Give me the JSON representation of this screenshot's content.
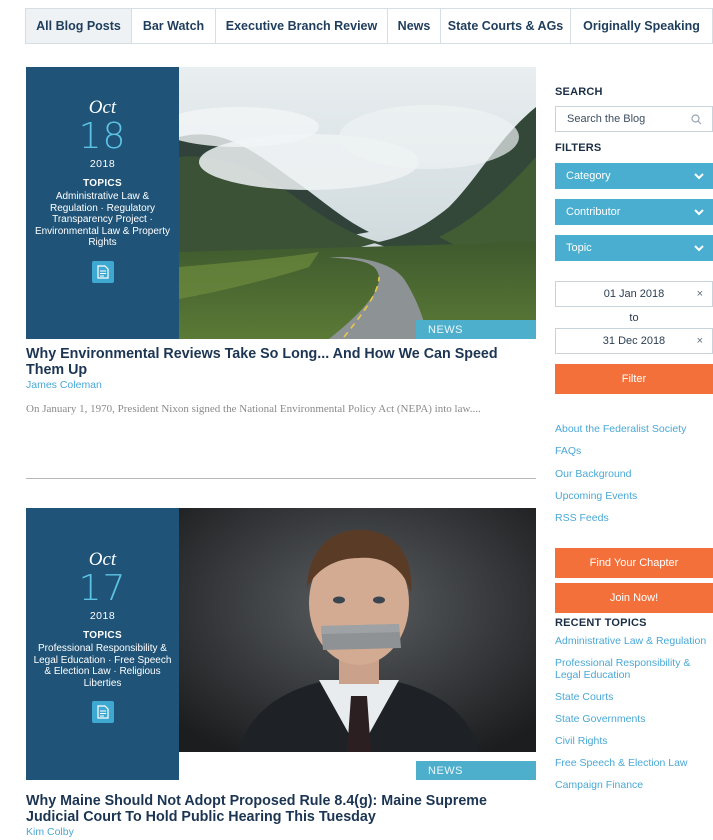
{
  "tabs": [
    {
      "label": "All Blog Posts"
    },
    {
      "label": "Bar Watch"
    },
    {
      "label": "Executive Branch Review"
    },
    {
      "label": "News"
    },
    {
      "label": "State Courts & AGs"
    },
    {
      "label": "Originally Speaking"
    }
  ],
  "posts": [
    {
      "month": "Oct",
      "day": "18",
      "year": "2018",
      "topics_label": "TOPICS",
      "topics": "Administrative Law & Regulation · Regulatory Transparency Project · Environmental Law & Property Rights",
      "tag": "NEWS",
      "title": "Why Environmental Reviews Take So Long... And How We Can Speed Them Up",
      "author": "James Coleman",
      "excerpt": "On January 1, 1970, President Nixon signed the National Environmental Policy Act (NEPA) into law....",
      "image": "misty-mountain-road"
    },
    {
      "month": "Oct",
      "day": "17",
      "year": "2018",
      "topics_label": "TOPICS",
      "topics": "Professional Responsibility & Legal Education · Free Speech & Election Law · Religious Liberties",
      "tag": "NEWS",
      "title": "Why Maine Should Not Adopt Proposed Rule 8.4(g): Maine Supreme Judicial Court To Hold Public Hearing This Tuesday",
      "author": "Kim Colby",
      "image": "man-with-taped-mouth"
    }
  ],
  "sidebar": {
    "search_heading": "SEARCH",
    "search_placeholder": "Search the Blog",
    "filters_heading": "FILTERS",
    "filters": [
      {
        "label": "Category"
      },
      {
        "label": "Contributor"
      },
      {
        "label": "Topic"
      }
    ],
    "date_from": "01 Jan 2018",
    "date_to_label": "to",
    "date_to": "31 Dec 2018",
    "clear_glyph": "×",
    "filter_button": "Filter",
    "links": [
      {
        "label": "About the Federalist Society"
      },
      {
        "label": "FAQs"
      },
      {
        "label": "Our Background"
      },
      {
        "label": "Upcoming Events"
      },
      {
        "label": "RSS Feeds"
      }
    ],
    "find_chapter_button": "Find Your Chapter",
    "join_button": "Join Now!",
    "recent_topics_heading": "RECENT TOPICS",
    "recent_topics": [
      {
        "label": "Administrative Law & Regulation"
      },
      {
        "label": "Professional Responsibility & Legal Education"
      },
      {
        "label": "State Courts"
      },
      {
        "label": "State Governments"
      },
      {
        "label": "Civil Rights"
      },
      {
        "label": "Free Speech & Election Law"
      },
      {
        "label": "Campaign Finance"
      }
    ]
  },
  "colors": {
    "navy": "#1f5478",
    "accent_blue": "#4aaed0",
    "link_blue": "#4aa8d6",
    "orange": "#f4703a",
    "title": "#1c3553"
  }
}
